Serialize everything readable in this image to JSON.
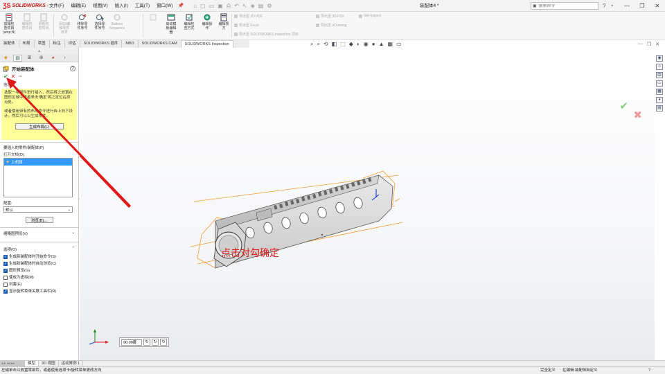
{
  "app": {
    "logo_text": "SOLIDWORKS",
    "menus": [
      "文件(F)",
      "编辑(E)",
      "视图(V)",
      "插入(I)",
      "工具(T)",
      "窗口(W)"
    ],
    "document_title": "装配体4 *",
    "search_placeholder": "搜索命令"
  },
  "command_manager": {
    "buttons": [
      {
        "label": "剪辑检\n查项目\n(amp;N)",
        "disabled": false
      },
      {
        "label": "编辑检\n查项目",
        "disabled": true
      },
      {
        "label": "更新检\n查项目",
        "disabled": true
      },
      {
        "label": "添加/编\n辑零件\n序号",
        "disabled": true
      },
      {
        "label": "移除零\n件序号",
        "disabled": false
      },
      {
        "label": "选择零\n件序号",
        "disabled": false
      },
      {
        "label": "Balloon\nSequence",
        "disabled": true
      },
      {
        "label": "启动模\n板编辑\n器",
        "disabled": false
      },
      {
        "label": "编辑检\n查方式",
        "disabled": false
      },
      {
        "label": "编辑操\n作",
        "disabled": false
      },
      {
        "label": "编辑规\n方",
        "disabled": false
      }
    ],
    "export_items": [
      "导出至 2D PDF",
      "导出至 Excel",
      "导出至 SOLIDWORKS Inspection 项目",
      "导出至 3D PDF",
      "导出至 eDrawing",
      "Net-Inspect"
    ]
  },
  "tabs": [
    {
      "label": "装配体",
      "active": false
    },
    {
      "label": "布局",
      "active": false
    },
    {
      "label": "草图",
      "active": false
    },
    {
      "label": "标注",
      "active": false
    },
    {
      "label": "评估",
      "active": false
    },
    {
      "label": "SOLIDWORKS 插件",
      "active": false
    },
    {
      "label": "MBD",
      "active": false
    },
    {
      "label": "SOLIDWORKS CAM",
      "active": false
    },
    {
      "label": "SOLIDWORKS Inspection",
      "active": true
    }
  ],
  "property_manager": {
    "title": "开始装配体",
    "message_label": "信息",
    "message_p1": "选取一零部件进行插入，然后将之放置在图形区域中或者单击'确定'将之定位在原点处。",
    "message_p2": "或者使用带有的布局命令进行自上向下设计。然后可以以生成零件。",
    "layout_button": "生成布局(L)",
    "insert_section": "要插入的零件/装配体(P)",
    "open_docs_label": "打开文档(D):",
    "open_docs": [
      "上机匣"
    ],
    "config_label": "配置:",
    "config_value": "默认",
    "browse_button": "浏览(B)...",
    "thumbnail_label": "缩略图预览(V)",
    "options_label": "选项(O)",
    "options": [
      {
        "label": "生成新装配体时开始命令(S)",
        "checked": true
      },
      {
        "label": "生成新装配体时自动浏览(C)",
        "checked": true
      },
      {
        "label": "图形预览(G)",
        "checked": true
      },
      {
        "label": "使成为虚拟(M)",
        "checked": false
      },
      {
        "label": "封套(E)",
        "checked": false
      },
      {
        "label": "显示旋转菜单关联工具栏(R)",
        "checked": true
      }
    ]
  },
  "viewport": {
    "annotation": "点击对勾确定",
    "rotation_value": "90.00度"
  },
  "bottom_tabs": [
    {
      "label": "模型",
      "active": true
    },
    {
      "label": "3D 视图",
      "active": false
    },
    {
      "label": "运动算例 1",
      "active": false
    }
  ],
  "status": {
    "message": "左键单击以放置零部件，或者使用选项卡/旋转菜单更改方向",
    "definition": "完全定义",
    "editing": "在编辑 装配体",
    "units": "自定义",
    "help": "?"
  },
  "colors": {
    "annotation_red": "#e0191a",
    "selection_blue": "#3399ff",
    "message_yellow": "#ffff99",
    "highlight_orange": "#f39a2e"
  }
}
